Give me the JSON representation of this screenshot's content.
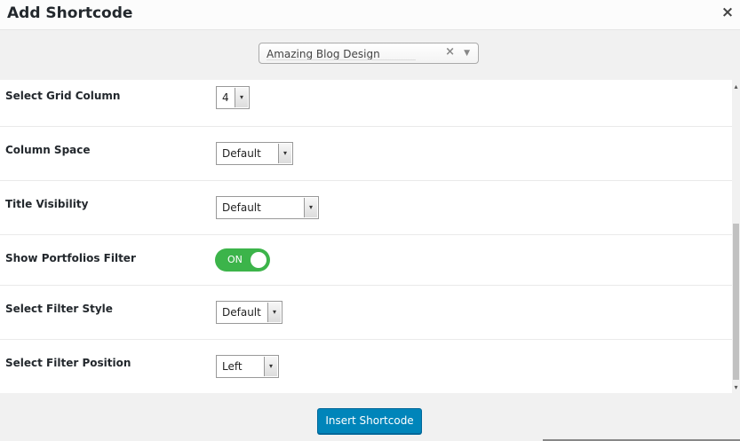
{
  "dialog": {
    "title": "Add Shortcode",
    "close_symbol": "×"
  },
  "layout_picker": {
    "value": "Amazing Blog Design",
    "clear_symbol": "×",
    "arrow_symbol": "▼"
  },
  "fields": {
    "grid_column": {
      "label": "Select Grid Column",
      "value": "4"
    },
    "column_space": {
      "label": "Column Space",
      "value": "Default"
    },
    "title_visibility": {
      "label": "Title Visibility",
      "value": "Default"
    },
    "portfolios_filter": {
      "label": "Show Portfolios Filter",
      "toggle_text": "ON",
      "enabled": true
    },
    "filter_style": {
      "label": "Select Filter Style",
      "value": "Default"
    },
    "filter_position": {
      "label": "Select Filter Position",
      "value": "Left"
    }
  },
  "dropdown_arrow": "▾",
  "scrollbar": {
    "up_arrow": "▴",
    "down_arrow": "▾"
  },
  "footer": {
    "insert_label": "Insert Shortcode"
  },
  "colors": {
    "toggle_on": "#3cb44a",
    "primary_button": "#0085ba"
  }
}
